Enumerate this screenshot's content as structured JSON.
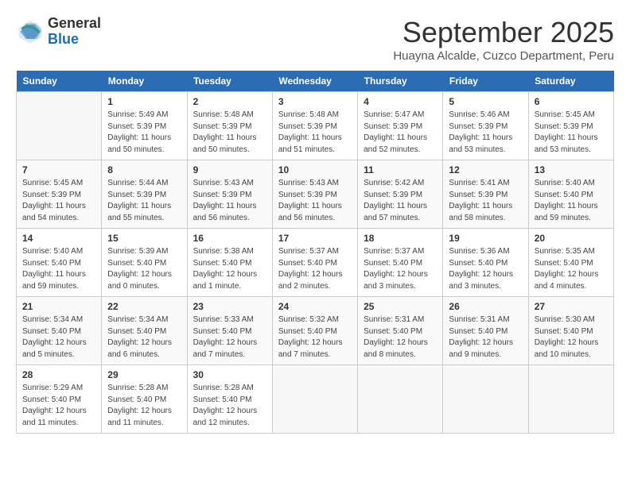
{
  "header": {
    "logo": {
      "line1": "General",
      "line2": "Blue"
    },
    "month": "September 2025",
    "location": "Huayna Alcalde, Cuzco Department, Peru"
  },
  "weekdays": [
    "Sunday",
    "Monday",
    "Tuesday",
    "Wednesday",
    "Thursday",
    "Friday",
    "Saturday"
  ],
  "weeks": [
    [
      {
        "day": "",
        "info": ""
      },
      {
        "day": "1",
        "info": "Sunrise: 5:49 AM\nSunset: 5:39 PM\nDaylight: 11 hours\nand 50 minutes."
      },
      {
        "day": "2",
        "info": "Sunrise: 5:48 AM\nSunset: 5:39 PM\nDaylight: 11 hours\nand 50 minutes."
      },
      {
        "day": "3",
        "info": "Sunrise: 5:48 AM\nSunset: 5:39 PM\nDaylight: 11 hours\nand 51 minutes."
      },
      {
        "day": "4",
        "info": "Sunrise: 5:47 AM\nSunset: 5:39 PM\nDaylight: 11 hours\nand 52 minutes."
      },
      {
        "day": "5",
        "info": "Sunrise: 5:46 AM\nSunset: 5:39 PM\nDaylight: 11 hours\nand 53 minutes."
      },
      {
        "day": "6",
        "info": "Sunrise: 5:45 AM\nSunset: 5:39 PM\nDaylight: 11 hours\nand 53 minutes."
      }
    ],
    [
      {
        "day": "7",
        "info": "Sunrise: 5:45 AM\nSunset: 5:39 PM\nDaylight: 11 hours\nand 54 minutes."
      },
      {
        "day": "8",
        "info": "Sunrise: 5:44 AM\nSunset: 5:39 PM\nDaylight: 11 hours\nand 55 minutes."
      },
      {
        "day": "9",
        "info": "Sunrise: 5:43 AM\nSunset: 5:39 PM\nDaylight: 11 hours\nand 56 minutes."
      },
      {
        "day": "10",
        "info": "Sunrise: 5:43 AM\nSunset: 5:39 PM\nDaylight: 11 hours\nand 56 minutes."
      },
      {
        "day": "11",
        "info": "Sunrise: 5:42 AM\nSunset: 5:39 PM\nDaylight: 11 hours\nand 57 minutes."
      },
      {
        "day": "12",
        "info": "Sunrise: 5:41 AM\nSunset: 5:39 PM\nDaylight: 11 hours\nand 58 minutes."
      },
      {
        "day": "13",
        "info": "Sunrise: 5:40 AM\nSunset: 5:40 PM\nDaylight: 11 hours\nand 59 minutes."
      }
    ],
    [
      {
        "day": "14",
        "info": "Sunrise: 5:40 AM\nSunset: 5:40 PM\nDaylight: 11 hours\nand 59 minutes."
      },
      {
        "day": "15",
        "info": "Sunrise: 5:39 AM\nSunset: 5:40 PM\nDaylight: 12 hours\nand 0 minutes."
      },
      {
        "day": "16",
        "info": "Sunrise: 5:38 AM\nSunset: 5:40 PM\nDaylight: 12 hours\nand 1 minute."
      },
      {
        "day": "17",
        "info": "Sunrise: 5:37 AM\nSunset: 5:40 PM\nDaylight: 12 hours\nand 2 minutes."
      },
      {
        "day": "18",
        "info": "Sunrise: 5:37 AM\nSunset: 5:40 PM\nDaylight: 12 hours\nand 3 minutes."
      },
      {
        "day": "19",
        "info": "Sunrise: 5:36 AM\nSunset: 5:40 PM\nDaylight: 12 hours\nand 3 minutes."
      },
      {
        "day": "20",
        "info": "Sunrise: 5:35 AM\nSunset: 5:40 PM\nDaylight: 12 hours\nand 4 minutes."
      }
    ],
    [
      {
        "day": "21",
        "info": "Sunrise: 5:34 AM\nSunset: 5:40 PM\nDaylight: 12 hours\nand 5 minutes."
      },
      {
        "day": "22",
        "info": "Sunrise: 5:34 AM\nSunset: 5:40 PM\nDaylight: 12 hours\nand 6 minutes."
      },
      {
        "day": "23",
        "info": "Sunrise: 5:33 AM\nSunset: 5:40 PM\nDaylight: 12 hours\nand 7 minutes."
      },
      {
        "day": "24",
        "info": "Sunrise: 5:32 AM\nSunset: 5:40 PM\nDaylight: 12 hours\nand 7 minutes."
      },
      {
        "day": "25",
        "info": "Sunrise: 5:31 AM\nSunset: 5:40 PM\nDaylight: 12 hours\nand 8 minutes."
      },
      {
        "day": "26",
        "info": "Sunrise: 5:31 AM\nSunset: 5:40 PM\nDaylight: 12 hours\nand 9 minutes."
      },
      {
        "day": "27",
        "info": "Sunrise: 5:30 AM\nSunset: 5:40 PM\nDaylight: 12 hours\nand 10 minutes."
      }
    ],
    [
      {
        "day": "28",
        "info": "Sunrise: 5:29 AM\nSunset: 5:40 PM\nDaylight: 12 hours\nand 11 minutes."
      },
      {
        "day": "29",
        "info": "Sunrise: 5:28 AM\nSunset: 5:40 PM\nDaylight: 12 hours\nand 11 minutes."
      },
      {
        "day": "30",
        "info": "Sunrise: 5:28 AM\nSunset: 5:40 PM\nDaylight: 12 hours\nand 12 minutes."
      },
      {
        "day": "",
        "info": ""
      },
      {
        "day": "",
        "info": ""
      },
      {
        "day": "",
        "info": ""
      },
      {
        "day": "",
        "info": ""
      }
    ]
  ]
}
